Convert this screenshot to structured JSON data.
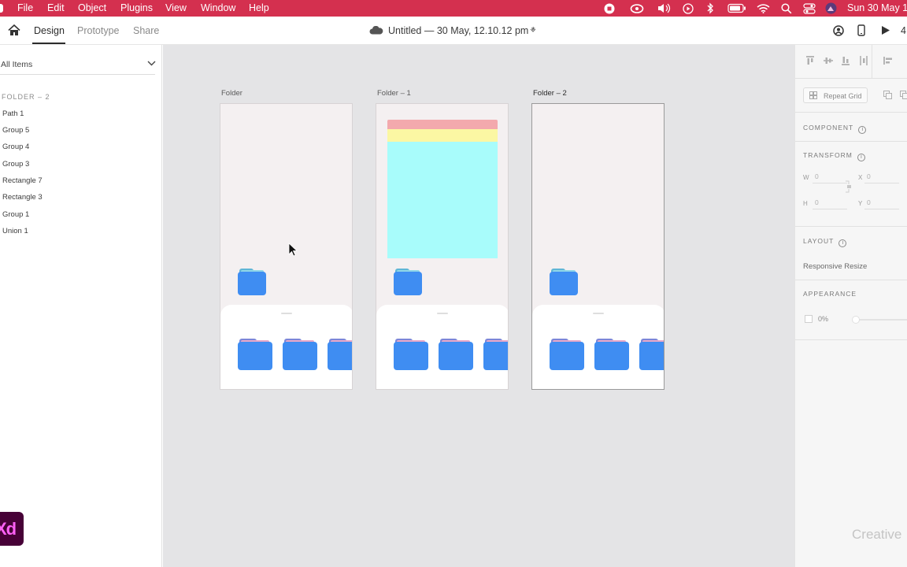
{
  "menubar": {
    "items": [
      "File",
      "Edit",
      "Object",
      "Plugins",
      "View",
      "Window",
      "Help"
    ],
    "clock": "Sun 30 May 1",
    "status_icons": [
      "record-icon",
      "creative-cloud-icon",
      "volume-icon",
      "play-circle-icon",
      "bluetooth-icon",
      "battery-icon",
      "wifi-icon",
      "search-icon",
      "control-center-icon",
      "user-avatar-icon"
    ]
  },
  "toolbar": {
    "tabs": [
      "Design",
      "Prototype",
      "Share"
    ],
    "active_tab": "Design",
    "doc_title": "Untitled — 30 May, 12.10.12 pm *",
    "zoom_partial": "4"
  },
  "layers": {
    "filter_label": "All Items",
    "folder_heading": "FOLDER – 2",
    "items": [
      "Path 1",
      "Group 5",
      "Group 4",
      "Group 3",
      "Rectangle 7",
      "Rectangle 3",
      "Group 1",
      "Union 1"
    ]
  },
  "app_logo": "Xd",
  "canvas": {
    "artboards": [
      {
        "label": "Folder",
        "selected": false
      },
      {
        "label": "Folder – 1",
        "selected": false
      },
      {
        "label": "Folder – 2",
        "selected": true
      }
    ]
  },
  "properties": {
    "repeat_grid_label": "Repeat Grid",
    "component_heading": "COMPONENT",
    "transform_heading": "TRANSFORM",
    "w_label": "W",
    "w_value": "0",
    "h_label": "H",
    "h_value": "0",
    "x_label": "X",
    "x_value": "0",
    "y_label": "Y",
    "y_value": "0",
    "layout_heading": "LAYOUT",
    "responsive_label": "Responsive Resize",
    "appearance_heading": "APPEARANCE",
    "opacity_value": "0%",
    "watermark": "Creative"
  },
  "colors": {
    "menubar": "#d4304f",
    "folder_blue": "#3f8df2",
    "card_pink": "#f3a9ad",
    "card_yellow": "#fbf7a3",
    "card_cyan": "#a8fcfb"
  }
}
